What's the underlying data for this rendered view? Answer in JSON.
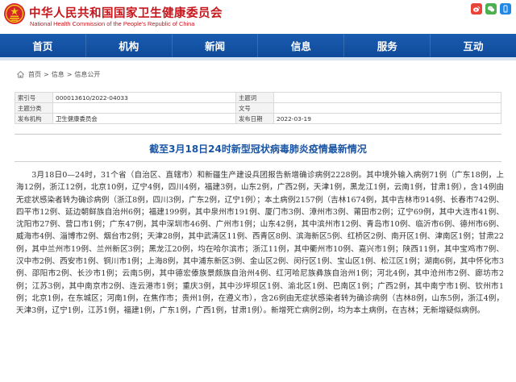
{
  "header": {
    "site_title": "中华人民共和国国家卫生健康委员会",
    "site_subtitle": "National Health Commission of the People's Republic of China",
    "util_icons": [
      "weibo-icon",
      "wechat-icon",
      "mobile-icon"
    ]
  },
  "nav": {
    "items": [
      {
        "label": "首页"
      },
      {
        "label": "机构"
      },
      {
        "label": "新闻"
      },
      {
        "label": "信息"
      },
      {
        "label": "服务"
      },
      {
        "label": "互动"
      }
    ]
  },
  "breadcrumb": {
    "items": [
      "首页",
      "信息",
      "信息公开"
    ],
    "separator": ">"
  },
  "meta": {
    "index_label": "索引号",
    "index_value": "000013610/2022-04033",
    "subject_label": "主题分类",
    "subject_value": "",
    "docno_label": "文号",
    "docno_value": "",
    "org_label": "发布机构",
    "org_value": "卫生健康委员会",
    "date_label": "发布日期",
    "date_value": "2022-03-19",
    "topic_label": "主题词",
    "topic_value": ""
  },
  "article": {
    "title": "截至3月18日24时新型冠状病毒肺炎疫情最新情况",
    "body": "3月18日0—24时，31个省（自治区、直辖市）和新疆生产建设兵团报告新增确诊病例2228例。其中境外输入病例71例（广东18例，上海12例，浙江12例，北京10例，辽宁4例，四川4例，福建3例，山东2例，广西2例，天津1例，黑龙江1例，云南1例，甘肃1例），含14例由无症状感染者转为确诊病例（浙江8例，四川3例，广东2例，辽宁1例）；本土病例2157例（吉林1674例，其中吉林市914例、长春市742例、四平市12例、延边朝鲜族自治州6例；福建199例，其中泉州市191例、厦门市3例、漳州市3例、莆田市2例；辽宁69例，其中大连市41例、沈阳市27例、营口市1例；广东47例，其中深圳市46例、广州市1例；山东42例，其中滨州市12例、青岛市10例、临沂市6例、德州市6例、威海市4例、淄博市2例、烟台市2例；天津28例，其中武清区11例、西青区8例、滨海新区5例、红桥区2例、南开区1例、津南区1例；甘肃22例，其中兰州市19例、兰州新区3例；黑龙江20例，均在哈尔滨市；浙江11例，其中衢州市10例、嘉兴市1例；陕西11例，其中宝鸡市7例、汉中市2例、西安市1例、铜川市1例；上海8例，其中浦东新区3例、金山区2例、闵行区1例、宝山区1例、松江区1例；湖南6例，其中怀化市3例、邵阳市2例、长沙市1例；云南5例，其中德宏傣族景颇族自治州4例、红河哈尼族彝族自治州1例；河北4例，其中沧州市2例、廊坊市2例；江苏3例，其中南京市2例、连云港市1例；重庆3例，其中沙坪坝区1例、渝北区1例、巴南区1例；广西2例，其中南宁市1例、钦州市1例；北京1例，在东城区；河南1例，在焦作市；贵州1例，在遵义市），含26例由无症状感染者转为确诊病例（吉林8例，山东5例，浙江4例，天津3例，辽宁1例，江苏1例，福建1例，广东1例，广西1例，甘肃1例）。新增死亡病例2例，均为本土病例，在吉林；无新增疑似病例。"
  },
  "colors": {
    "brand_red": "#c8161d",
    "nav_blue": "#1357a6",
    "title_blue": "#1a55a6"
  }
}
